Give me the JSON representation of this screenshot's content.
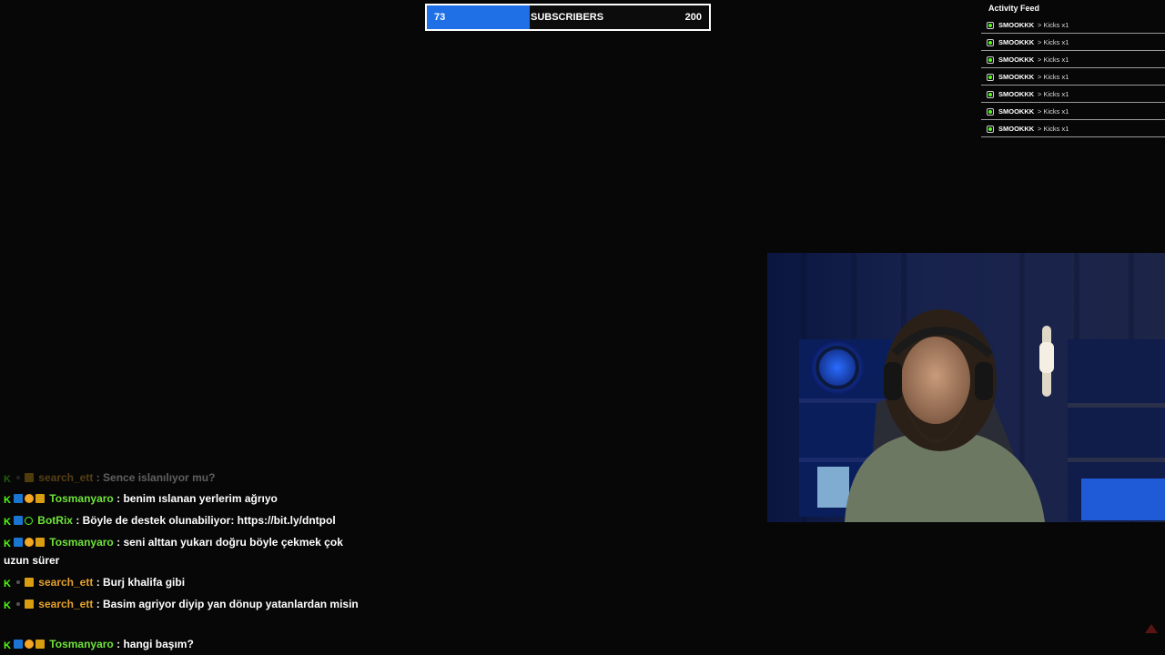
{
  "sub_goal": {
    "current": "73",
    "label": "SUBSCRIBERS",
    "target": "200",
    "progress": 0.365,
    "fill_color": "#1f6fe6"
  },
  "activity_feed": {
    "title": "Activity Feed",
    "items": [
      {
        "user": "SMOOKKK",
        "action": "> Kicks x1"
      },
      {
        "user": "SMOOKKK",
        "action": "> Kicks x1"
      },
      {
        "user": "SMOOKKK",
        "action": "> Kicks x1"
      },
      {
        "user": "SMOOKKK",
        "action": "> Kicks x1"
      },
      {
        "user": "SMOOKKK",
        "action": "> Kicks x1"
      },
      {
        "user": "SMOOKKK",
        "action": "> Kicks x1"
      },
      {
        "user": "SMOOKKK",
        "action": "> Kicks x1"
      }
    ]
  },
  "chat": {
    "messages": [
      {
        "user": "search_ett",
        "user_color": "#e5a22c",
        "text": ": Sence islanılıyor mu?",
        "badges": [
          "kick-icon",
          "dot-icon",
          "crown-icon"
        ]
      },
      {
        "user": "Tosmanyaro",
        "user_color": "#6fe33a",
        "text": ": benim ıslanan yerlerim ağrıyo",
        "badges": [
          "kick-icon",
          "subscriber-icon",
          "vip-icon",
          "crown-icon"
        ]
      },
      {
        "user": "BotRix",
        "user_color": "#6fe33a",
        "text": ": Böyle de destek olunabiliyor: https://bit.ly/dntpol",
        "badges": [
          "kick-icon",
          "subscriber-icon",
          "bot-icon"
        ]
      },
      {
        "user": "Tosmanyaro",
        "user_color": "#6fe33a",
        "text": ": seni alttan yukarı doğru böyle çekmek çok uzun sürer",
        "badges": [
          "kick-icon",
          "subscriber-icon",
          "vip-icon",
          "crown-icon"
        ]
      },
      {
        "user": "search_ett",
        "user_color": "#e5a22c",
        "text": ": Burj khalifa gibi",
        "badges": [
          "kick-icon",
          "dot-icon",
          "crown-icon"
        ]
      },
      {
        "user": "search_ett",
        "user_color": "#e5a22c",
        "text": ": Basim agriyor diyip yan dönup yatanlardan misin",
        "badges": [
          "kick-icon",
          "dot-icon",
          "crown-icon"
        ]
      },
      {
        "user": "Tosmanyaro",
        "user_color": "#6fe33a",
        "text": ": hangi başım?",
        "badges": [
          "kick-icon",
          "subscriber-icon",
          "vip-icon",
          "crown-icon"
        ]
      }
    ]
  },
  "colors": {
    "kick_green": "#53fc18",
    "background": "#070707"
  }
}
